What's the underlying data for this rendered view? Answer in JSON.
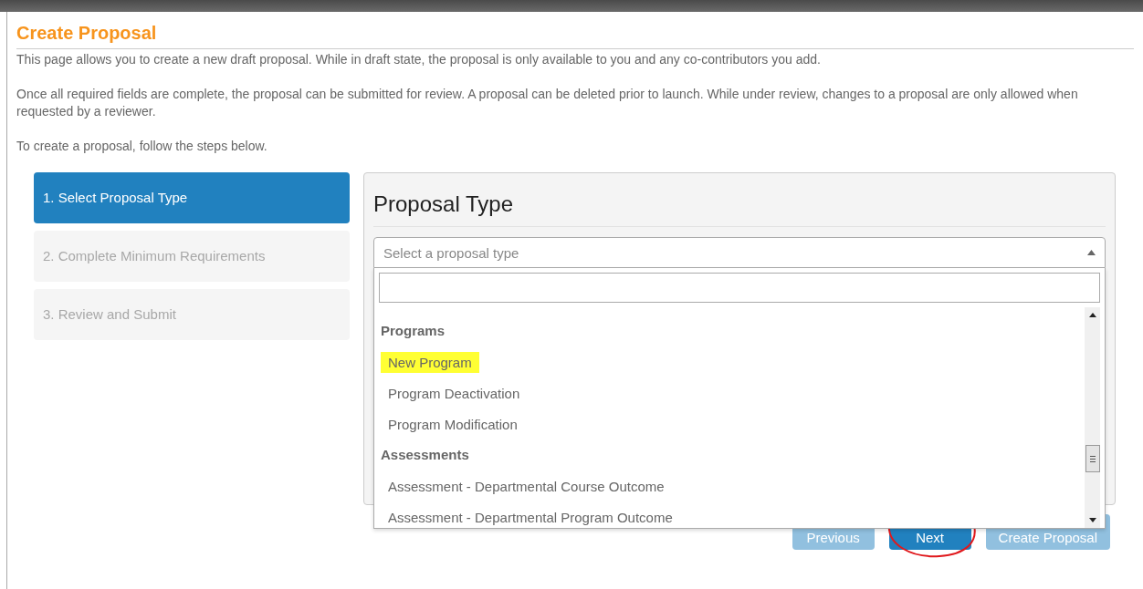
{
  "page": {
    "title": "Create Proposal",
    "paragraphs": [
      "This page allows you to create a new draft proposal. While in draft state, the proposal is only available to you and any co-contributors you add.",
      "Once all required fields are complete, the proposal can be submitted for review. A proposal can be deleted prior to launch. While under review, changes to a proposal are only allowed when requested by a reviewer.",
      "To create a proposal, follow the steps below."
    ]
  },
  "steps": [
    {
      "label": "1. Select Proposal Type",
      "selected": true,
      "disabled": false
    },
    {
      "label": "2. Complete Minimum Requirements",
      "selected": false,
      "disabled": true
    },
    {
      "label": "3. Review and Submit",
      "selected": false,
      "disabled": true
    }
  ],
  "panel": {
    "title": "Proposal Type",
    "select": {
      "placeholder": "Select a proposal type",
      "expanded": true
    },
    "groups": [
      {
        "label": "Programs",
        "options": [
          {
            "label": "New Program",
            "highlighted": true
          },
          {
            "label": "Program Deactivation",
            "highlighted": false
          },
          {
            "label": "Program Modification",
            "highlighted": false
          }
        ]
      },
      {
        "label": "Assessments",
        "options": [
          {
            "label": "Assessment - Departmental Course Outcome",
            "highlighted": false
          },
          {
            "label": "Assessment - Departmental Program Outcome",
            "highlighted": false
          }
        ]
      }
    ]
  },
  "buttons": [
    {
      "label": "Previous",
      "disabled": true,
      "circled": false
    },
    {
      "label": "Next",
      "disabled": false,
      "circled": true
    },
    {
      "label": "Create Proposal",
      "disabled": true,
      "circled": false
    }
  ]
}
